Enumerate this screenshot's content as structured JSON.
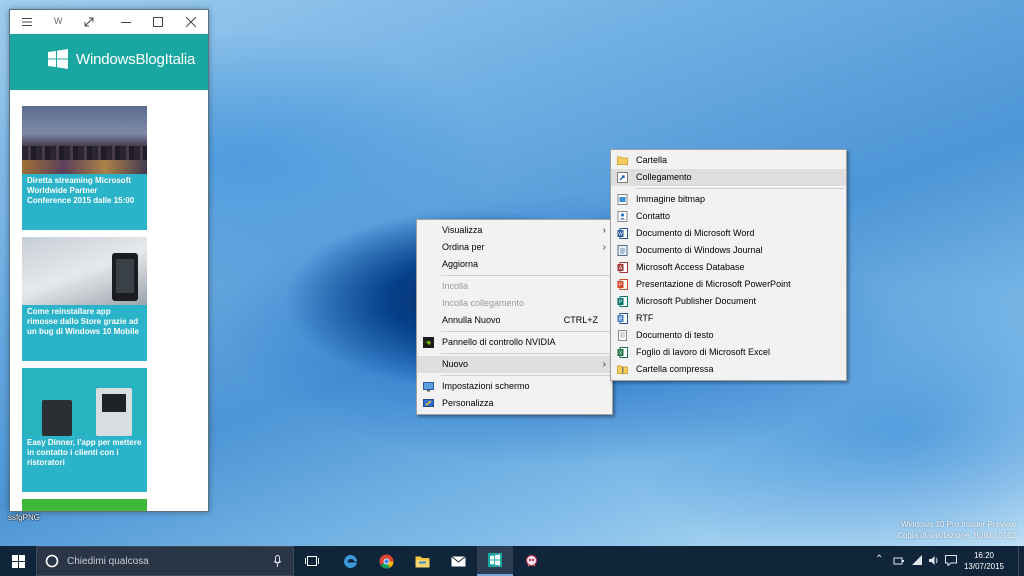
{
  "app_window": {
    "title_letter": "W",
    "brand_name": "WindowsBlogItalia",
    "articles": [
      {
        "text": "Diretta streaming Microsoft Worldwide Partner Conference 2015 dalle 15:00"
      },
      {
        "text": "Come reinstallare app rimosse dallo Store grazie ad un bug di Windows 10 Mobile"
      },
      {
        "text": "Easy Dinner, l'app per mettere in contatto i clienti con i ristoratori"
      }
    ]
  },
  "desktop": {
    "icon_label": "ssfgPNG",
    "watermark_line1": "Windows 10 Pro Insider Preview",
    "watermark_line2": "Copia di valutazione. Build 10162"
  },
  "context_menu": {
    "items": [
      {
        "label": "Visualizza",
        "submenu": true
      },
      {
        "label": "Ordina per",
        "submenu": true
      },
      {
        "label": "Aggiorna"
      },
      {
        "label": "Incolla",
        "disabled": true
      },
      {
        "label": "Incolla collegamento",
        "disabled": true
      },
      {
        "label": "Annulla Nuovo",
        "shortcut": "CTRL+Z"
      },
      {
        "label": "Pannello di controllo NVIDIA",
        "icon": "nvidia-icon"
      },
      {
        "label": "Nuovo",
        "submenu": true,
        "highlighted": true
      },
      {
        "label": "Impostazioni schermo",
        "icon": "display-settings-icon"
      },
      {
        "label": "Personalizza",
        "icon": "personalize-icon"
      }
    ]
  },
  "new_submenu": {
    "items": [
      {
        "label": "Cartella",
        "icon": "folder-icon"
      },
      {
        "label": "Collegamento",
        "icon": "shortcut-icon",
        "highlighted": true
      },
      {
        "label": "Immagine bitmap",
        "icon": "bitmap-icon"
      },
      {
        "label": "Contatto",
        "icon": "contact-icon"
      },
      {
        "label": "Documento di Microsoft Word",
        "icon": "word-icon"
      },
      {
        "label": "Documento di Windows Journal",
        "icon": "journal-icon"
      },
      {
        "label": "Microsoft Access Database",
        "icon": "access-icon"
      },
      {
        "label": "Presentazione di Microsoft PowerPoint",
        "icon": "powerpoint-icon"
      },
      {
        "label": "Microsoft Publisher Document",
        "icon": "publisher-icon"
      },
      {
        "label": "RTF",
        "icon": "rtf-icon"
      },
      {
        "label": "Documento di testo",
        "icon": "text-doc-icon"
      },
      {
        "label": "Foglio di lavoro di Microsoft Excel",
        "icon": "excel-icon"
      },
      {
        "label": "Cartella compressa",
        "icon": "zip-folder-icon"
      }
    ]
  },
  "taskbar": {
    "search_placeholder": "Chiedimi qualcosa",
    "clock_time": "16:20",
    "clock_date": "13/07/2015"
  },
  "colors": {
    "app_accent": "#1aa7a1",
    "card_blue": "#2bb3c9",
    "card_green": "#3fb83a",
    "taskbar": "#10243a"
  }
}
